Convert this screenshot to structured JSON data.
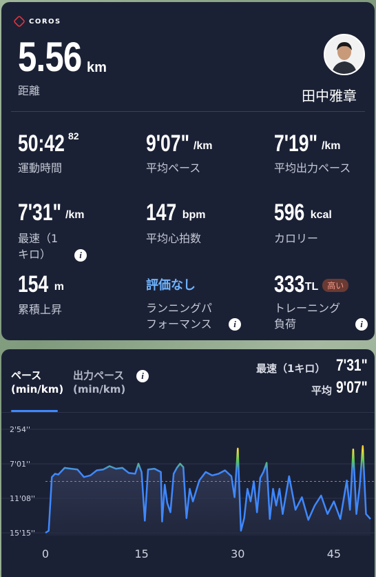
{
  "brand": "COROS",
  "distance": {
    "value": "5.56",
    "unit": "km",
    "label": "距離"
  },
  "user": {
    "name": "田中雅章"
  },
  "stats": [
    {
      "value": "50:42",
      "sup": "82",
      "unit": "",
      "label": "運動時間"
    },
    {
      "value": "9'07\"",
      "unit": "/km",
      "label": "平均ペース"
    },
    {
      "value": "7'19\"",
      "unit": "/km",
      "label": "平均出力ペース"
    },
    {
      "value": "7'31\"",
      "unit": "/km",
      "label": "最速（1キロ）"
    },
    {
      "value": "147",
      "unit": "bpm",
      "label": "平均心拍数"
    },
    {
      "value": "596",
      "unit": "kcal",
      "label": "カロリー"
    },
    {
      "value": "154",
      "unit": "m",
      "label": "累積上昇"
    },
    {
      "value": "評価なし",
      "unit": "",
      "label": "ランニングパフォーマンス"
    },
    {
      "value": "333",
      "unit": "TL",
      "badge": "高い",
      "label": "トレーニング負荷"
    }
  ],
  "labels_split": {
    "fastest_line1": "最速（1",
    "fastest_line2": "キロ）",
    "perf_line1": "ランニングパ",
    "perf_line2": "フォーマンス",
    "load_line1": "トレーニング",
    "load_line2": "負荷"
  },
  "chart_panel": {
    "tab_active": {
      "line1": "ペース",
      "line2": "(min/km)"
    },
    "tab_other": {
      "line1": "出力ペース",
      "line2": "(min/km)"
    },
    "fastest_label": "最速（1キロ）",
    "fastest_value": "7'31\"",
    "avg_label": "平均",
    "avg_value": "9'07\""
  },
  "chart_data": {
    "type": "area",
    "title": "",
    "xlabel": "",
    "ylabel": "",
    "x_ticks": [
      "0",
      "15",
      "30",
      "45"
    ],
    "y_ticks": [
      "2'54''",
      "7'01''",
      "11'08''",
      "15'15''"
    ],
    "y_inverted": true,
    "xlim": [
      0,
      50.7
    ],
    "ylim_minutes": [
      2.9,
      15.25
    ],
    "average_pace_minutes": 9.12,
    "series": [
      {
        "x": [
          0,
          0.5,
          1,
          1.5,
          2,
          3,
          4,
          5,
          6,
          7,
          8,
          9,
          10,
          11,
          12,
          13,
          14,
          14.5,
          15,
          15.5,
          16,
          17,
          18,
          18.2,
          18.6,
          19,
          19.5,
          20,
          20.5,
          21,
          21.5,
          22,
          22.5,
          23,
          24,
          25,
          26,
          27,
          28,
          29,
          29.5,
          30,
          30.5,
          31,
          31.5,
          32,
          32.5,
          33,
          33.5,
          34,
          34.5,
          35,
          35.5,
          36,
          36.5,
          37,
          38,
          39,
          40,
          41,
          42,
          43,
          44,
          45,
          46,
          47,
          47.5,
          48,
          48.5,
          49,
          49.5,
          50,
          50.7
        ],
        "minutes": [
          15.25,
          15.0,
          8.6,
          8.2,
          8.3,
          7.5,
          7.6,
          7.7,
          8.6,
          8.4,
          7.8,
          7.7,
          7.3,
          7.6,
          7.5,
          8.1,
          8.2,
          7.0,
          8.0,
          13.8,
          7.7,
          7.6,
          8.0,
          13.9,
          9.5,
          11.7,
          12.8,
          8.2,
          7.5,
          7.0,
          7.4,
          13.5,
          10.0,
          11.5,
          9.0,
          8.0,
          8.4,
          8.2,
          7.8,
          8.5,
          11.0,
          5.2,
          15.0,
          13.5,
          10.0,
          11.5,
          9.1,
          12.8,
          8.7,
          8.0,
          6.9,
          13.6,
          10.0,
          12.0,
          10.0,
          13.0,
          8.5,
          12.5,
          11.0,
          13.7,
          12.0,
          10.8,
          13.0,
          11.5,
          13.6,
          9.0,
          12.5,
          5.3,
          13.0,
          9.8,
          4.9,
          13.0,
          13.6
        ]
      }
    ]
  }
}
